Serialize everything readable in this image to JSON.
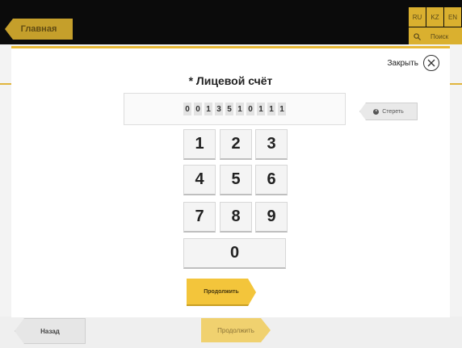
{
  "header": {
    "home_label": "Главная",
    "languages": [
      "RU",
      "KZ",
      "EN"
    ],
    "search_label": "Поиск"
  },
  "footer": {
    "back_label": "Назад",
    "continue_label": "Продолжить"
  },
  "modal": {
    "close_label": "Закрыть",
    "title": "* Лицевой счёт",
    "account_digits": [
      "0",
      "0",
      "1",
      "3",
      "5",
      "1",
      "0",
      "1",
      "1",
      "1"
    ],
    "clear_label": "Стереть",
    "keypad": [
      "1",
      "2",
      "3",
      "4",
      "5",
      "6",
      "7",
      "8",
      "9",
      "0"
    ],
    "continue_label": "Продолжить"
  },
  "colors": {
    "accent": "#f3c53b",
    "topbar": "#0b0b0b"
  }
}
